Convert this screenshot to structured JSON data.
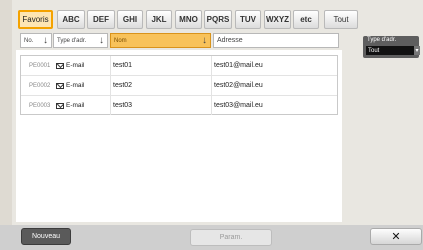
{
  "tabs": [
    {
      "label": "Favoris",
      "active": true
    },
    {
      "label": "ABC"
    },
    {
      "label": "DEF"
    },
    {
      "label": "GHI"
    },
    {
      "label": "JKL"
    },
    {
      "label": "MNO"
    },
    {
      "label": "PQRS"
    },
    {
      "label": "TUV"
    },
    {
      "label": "WXYZ"
    },
    {
      "label": "etc"
    },
    {
      "label": "Tout"
    }
  ],
  "columns": {
    "no": "No.",
    "type": "Type d'adr.",
    "name": "Nom",
    "address": "Adresse"
  },
  "rows": [
    {
      "no": "PE0001",
      "type": "E-mail",
      "name": "test01",
      "address": "test01@mail.eu"
    },
    {
      "no": "PE0002",
      "type": "E-mail",
      "name": "test02",
      "address": "test02@mail.eu"
    },
    {
      "no": "PE0003",
      "type": "E-mail",
      "name": "test03",
      "address": "test03@mail.eu"
    }
  ],
  "filter": {
    "label": "Type d'adr.",
    "value": "Tout"
  },
  "buttons": {
    "new": "Nouveau",
    "params": "Param.",
    "close": "✕"
  },
  "colors": {
    "active_tab": "#fde5b3",
    "sorted_header": "#f8c25a"
  }
}
